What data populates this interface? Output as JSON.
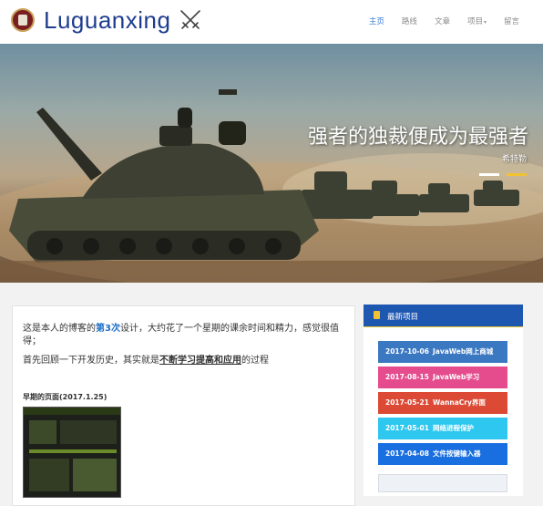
{
  "header": {
    "brand": "Luguanxing",
    "nav": [
      {
        "label": "主页",
        "active": true
      },
      {
        "label": "路线",
        "active": false
      },
      {
        "label": "文章",
        "active": false
      },
      {
        "label": "项目",
        "active": false,
        "dropdown": true
      },
      {
        "label": "留言",
        "active": false
      }
    ]
  },
  "hero": {
    "title": "强者的独裁便成为最强者",
    "author": "希特勒"
  },
  "intro": {
    "p1_before": "这是本人的博客的",
    "p1_highlight": "第3次",
    "p1_after": "设计，大约花了一个星期的课余时间和精力，感觉很值得；",
    "p2_before": "首先回顾一下开发历史，其实就是",
    "p2_underline": "不断学习提高和应用",
    "p2_after": "的过程",
    "early_label": "早期的页面(2017.1.25)"
  },
  "sidebar": {
    "title": "最新项目",
    "projects": [
      {
        "date": "2017-10-06",
        "title": "JavaWeb网上商城",
        "color": "#3a78c2"
      },
      {
        "date": "2017-08-15",
        "title": "JavaWeb学习",
        "color": "#e44c8e"
      },
      {
        "date": "2017-05-21",
        "title": "WannaCry界面",
        "color": "#dc4a35"
      },
      {
        "date": "2017-05-01",
        "title": "网络进程保护",
        "color": "#2ec7ef"
      },
      {
        "date": "2017-04-08",
        "title": "文件按键输入器",
        "color": "#1a6fe0"
      }
    ]
  },
  "colors": {
    "brand": "#1e3d8f",
    "nav_active": "#3a7bd5",
    "sidebar_head": "#1e57b0",
    "highlight": "#1e6fc9"
  }
}
